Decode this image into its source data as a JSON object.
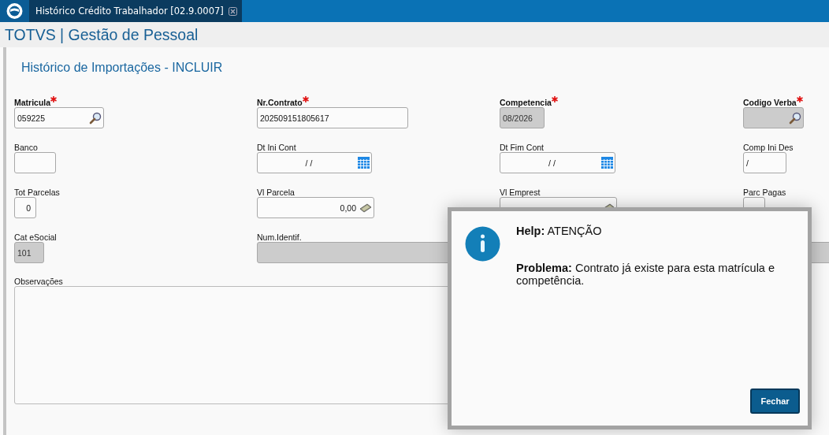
{
  "tab": {
    "title": "Histórico Crédito Trabalhador [02.9.0007]"
  },
  "app_title": "TOTVS | Gestão de Pessoal",
  "form": {
    "title": "Histórico de Importações - INCLUIR",
    "fields": [
      {
        "label": "Matricula",
        "kind": "lookup",
        "required": true,
        "disabled": false,
        "value": "059225"
      },
      {
        "label": "Nr.Contrato",
        "kind": "text",
        "required": true,
        "disabled": false,
        "value": "202509151805617"
      },
      {
        "label": "Competencia",
        "kind": "text",
        "required": true,
        "disabled": true,
        "value": "08/2026"
      },
      {
        "label": "Codigo Verba",
        "kind": "lookup",
        "required": true,
        "disabled": true
      },
      {
        "label": "Banco",
        "kind": "text",
        "required": false,
        "disabled": false
      },
      {
        "label": "Dt Ini Cont",
        "kind": "date",
        "required": false,
        "disabled": false,
        "value": "/ /"
      },
      {
        "label": "Dt Fim Cont",
        "kind": "date",
        "required": false,
        "disabled": false,
        "value": "/ /"
      },
      {
        "label": "Comp Ini Des",
        "kind": "text",
        "required": false,
        "disabled": false,
        "value": "/"
      },
      {
        "label": "Tot Parcelas",
        "kind": "number",
        "required": false,
        "disabled": false,
        "value": "0"
      },
      {
        "label": "Vl Parcela",
        "kind": "money",
        "required": false,
        "disabled": false,
        "value": "0,00"
      },
      {
        "label": "Vl Emprest",
        "kind": "money",
        "required": false,
        "disabled": false
      },
      {
        "label": "Parc Pagas",
        "kind": "number",
        "required": false,
        "disabled": false
      },
      {
        "label": "Cat eSocial",
        "kind": "text",
        "required": false,
        "disabled": true,
        "value": "101"
      },
      {
        "label": "Num.Identif.",
        "kind": "text",
        "required": false,
        "disabled": true
      }
    ],
    "notes": {
      "label": "Observações"
    }
  },
  "dialog": {
    "heading_label": "Help:",
    "heading": "ATENÇÃO",
    "message": "**Problema:** Contrato já existe para esta matrícula e competência.",
    "button": "Fechar"
  }
}
